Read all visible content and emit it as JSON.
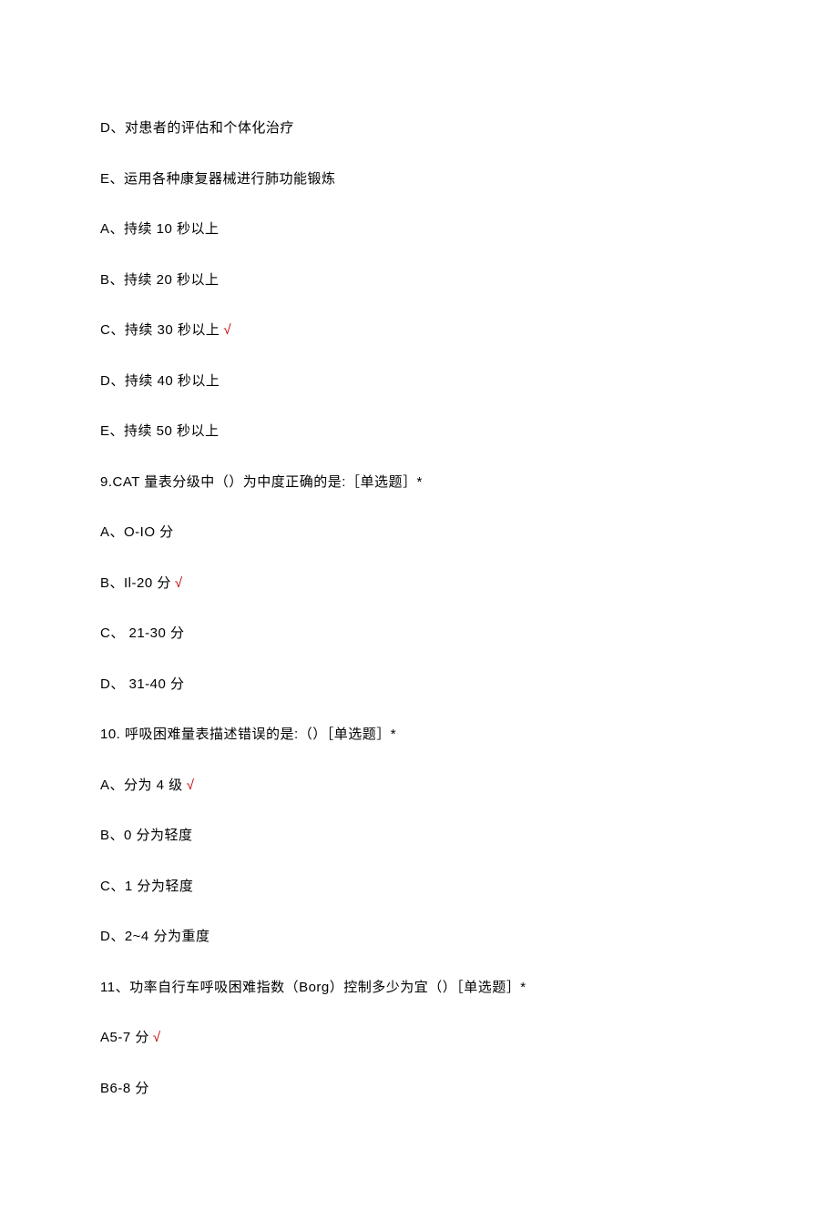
{
  "lines": [
    {
      "text": "D、对患者的评估和个体化治疗",
      "correct": false
    },
    {
      "text": "E、运用各种康复器械进行肺功能锻炼",
      "correct": false
    },
    {
      "text": "A、持续 10 秒以上",
      "correct": false
    },
    {
      "text": "B、持续 20 秒以上",
      "correct": false
    },
    {
      "text": "C、持续 30 秒以上",
      "correct": true
    },
    {
      "text": "D、持续 40 秒以上",
      "correct": false
    },
    {
      "text": "E、持续 50 秒以上",
      "correct": false
    },
    {
      "text": "9.CAT 量表分级中（）为中度正确的是:［单选题］*",
      "correct": false
    },
    {
      "text": "A、O-IO 分",
      "correct": false
    },
    {
      "text": "B、Il-20 分",
      "correct": true
    },
    {
      "text": "C、 21-30 分",
      "correct": false
    },
    {
      "text": "D、 31-40 分",
      "correct": false
    },
    {
      "text": "10. 呼吸困难量表描述错误的是:（）［单选题］*",
      "correct": false
    },
    {
      "text": "A、分为 4 级",
      "correct": true
    },
    {
      "text": "B、0 分为轻度",
      "correct": false
    },
    {
      "text": "C、1 分为轻度",
      "correct": false
    },
    {
      "text": "D、2~4 分为重度",
      "correct": false
    },
    {
      "text": "11、功率自行车呼吸困难指数（Borg）控制多少为宜（）［单选题］*",
      "correct": false
    },
    {
      "text": "A5-7 分",
      "correct": true
    },
    {
      "text": "B6-8 分",
      "correct": false
    }
  ],
  "checkmark": "√"
}
